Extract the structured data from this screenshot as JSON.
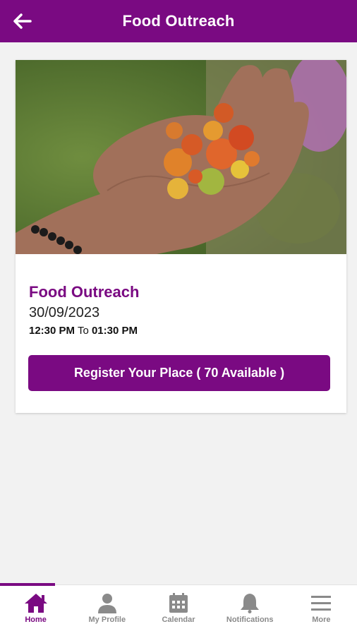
{
  "header": {
    "title": "Food Outreach",
    "back_icon": "arrow-left-icon"
  },
  "event": {
    "name": "Food Outreach",
    "date": "30/09/2023",
    "time_start": "12:30 PM",
    "time_separator": "To",
    "time_end": "01:30 PM",
    "register_label": "Register Your Place ( 70 Available )"
  },
  "bottom_nav": {
    "items": [
      {
        "label": "Home",
        "icon": "home-icon",
        "active": true
      },
      {
        "label": "My Profile",
        "icon": "person-icon"
      },
      {
        "label": "Calendar",
        "icon": "calendar-icon"
      },
      {
        "label": "Notifications",
        "icon": "bell-icon"
      },
      {
        "label": "More",
        "icon": "menu-icon"
      }
    ]
  },
  "colors": {
    "brand": "#7a0a82",
    "nav_inactive": "#8a8a8a",
    "background": "#f2f2f2"
  }
}
